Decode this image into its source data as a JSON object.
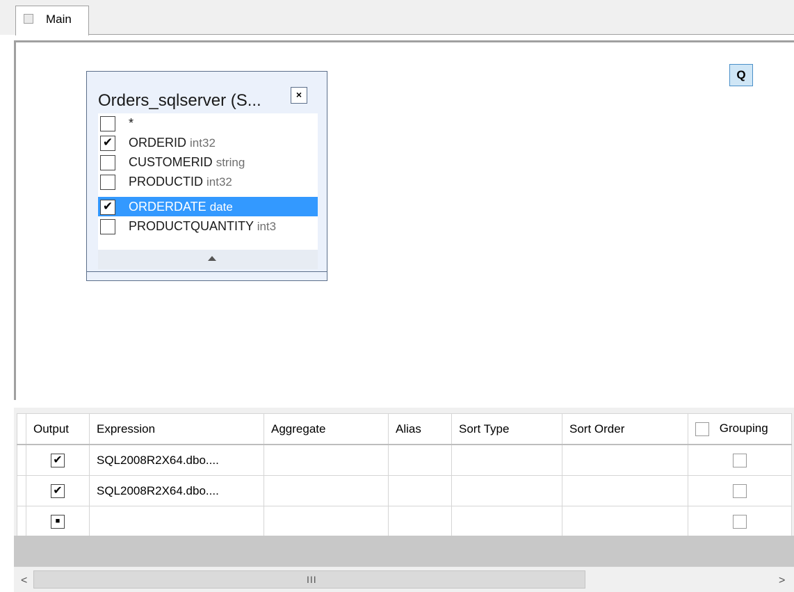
{
  "tab": {
    "label": "Main"
  },
  "canvas": {
    "query_button": "Q"
  },
  "table_window": {
    "title": "Orders_sqlserver (S...",
    "close": "×",
    "fields": [
      {
        "name": "*",
        "type": "",
        "checked": false,
        "selected": false
      },
      {
        "name": "ORDERID",
        "type": "int32",
        "checked": true,
        "selected": false
      },
      {
        "name": "CUSTOMERID",
        "type": "string",
        "checked": false,
        "selected": false
      },
      {
        "name": "PRODUCTID",
        "type": "int32",
        "checked": false,
        "selected": false
      },
      {
        "name": "ORDERDATE",
        "type": "date",
        "checked": true,
        "selected": true
      },
      {
        "name": "PRODUCTQUANTITY",
        "type": "int3",
        "checked": false,
        "selected": false
      }
    ]
  },
  "grid": {
    "columns": {
      "output": "Output",
      "expression": "Expression",
      "aggregate": "Aggregate",
      "alias": "Alias",
      "sort_type": "Sort Type",
      "sort_order": "Sort Order",
      "grouping": "Grouping"
    },
    "rows": [
      {
        "output": "✔",
        "expression": "SQL2008R2X64.dbo....",
        "aggregate": "",
        "alias": "",
        "sort_type": "",
        "sort_order": ""
      },
      {
        "output": "✔",
        "expression": "SQL2008R2X64.dbo....",
        "aggregate": "",
        "alias": "",
        "sort_type": "",
        "sort_order": ""
      },
      {
        "output": "■",
        "expression": "",
        "aggregate": "",
        "alias": "",
        "sort_type": "",
        "sort_order": ""
      }
    ]
  },
  "scrollbar": {
    "left": "<",
    "grip": "III",
    "right": ">"
  }
}
